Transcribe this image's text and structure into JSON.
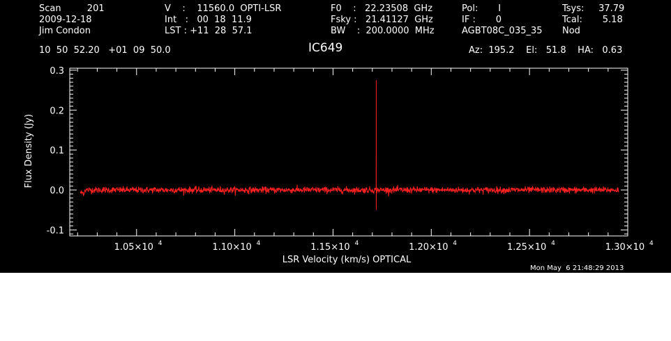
{
  "header": {
    "scan_line": "Scan         201",
    "date": "2009-12-18",
    "observer": "Jim Condon",
    "velocity_line": "V    :    11560.0  OPTI-LSR",
    "int_line": "Int   :   00  18  11.9",
    "lst_line": "LST : +11  28  57.1",
    "f0_line": "F0    :   22.23508  GHz",
    "fsky_line": "Fsky :   21.41127  GHz",
    "bw_line": "BW    :  200.0000  MHz",
    "pol_line": "Pol:       I",
    "if_line": "IF :       0",
    "project": "AGBT08C_035_35",
    "tsys_line": "Tsys:     37.79",
    "tcal_line": "Tcal:       5.18",
    "mode": "Nod",
    "coords": "10  50  52.20   +01  09  50.0",
    "source": "IC649",
    "pointing": "Az:  195.2    El:   51.8    HA:   0.63",
    "timestamp": "Mon May  6 21:48:29 2013"
  },
  "chart_data": {
    "type": "line",
    "title": "IC649",
    "xlabel": "LSR Velocity (km/s) OPTICAL",
    "ylabel": "Flux Density (Jy)",
    "xlim": [
      10160,
      13000
    ],
    "ylim": [
      -0.115,
      0.305
    ],
    "x_ticks": [
      {
        "value": 10500,
        "label": "1.05×10",
        "exp": "4"
      },
      {
        "value": 11000,
        "label": "1.10×10",
        "exp": "4"
      },
      {
        "value": 11500,
        "label": "1.15×10",
        "exp": "4"
      },
      {
        "value": 12000,
        "label": "1.20×10",
        "exp": "4"
      },
      {
        "value": 12500,
        "label": "1.25×10",
        "exp": "4"
      },
      {
        "value": 13000,
        "label": "1.30×10",
        "exp": "4"
      }
    ],
    "y_ticks": [
      {
        "value": 0.3,
        "label": "0.3"
      },
      {
        "value": 0.2,
        "label": "0.2"
      },
      {
        "value": 0.1,
        "label": "0.1"
      },
      {
        "value": 0.0,
        "label": "0.0"
      },
      {
        "value": -0.1,
        "label": "-0.1"
      }
    ],
    "series": [
      {
        "color": "#ff2020",
        "x_start": 10215,
        "x_end": 12955,
        "baseline": 0.0,
        "noise_rms": 0.004,
        "spike": {
          "x": 11720,
          "peak": 0.275,
          "min": -0.05
        }
      }
    ]
  }
}
